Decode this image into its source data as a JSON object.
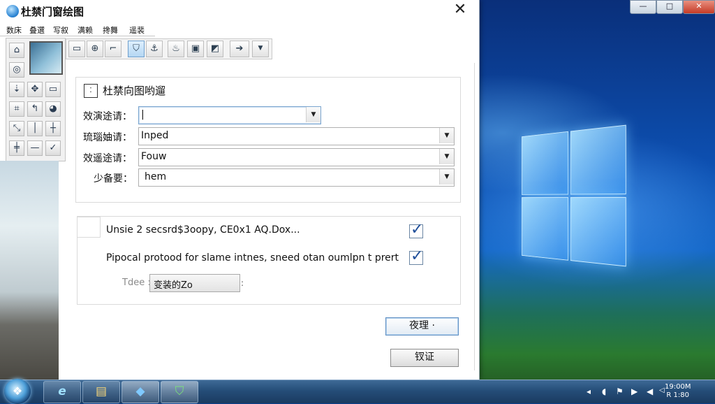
{
  "window": {
    "title": "杜禁门窗绘图",
    "close_glyph": "✕"
  },
  "menu": [
    "数床",
    "叠選",
    "写叙",
    "满赖",
    "搀舞",
    "遥裴"
  ],
  "left_tools": [
    {
      "icon": "home-icon",
      "glyph": "⌂"
    },
    {
      "icon": "circle-icon",
      "glyph": "◎"
    },
    {
      "icon": "arrow-down-icon",
      "glyph": "⇣"
    },
    {
      "icon": "move-icon",
      "glyph": "✥"
    },
    {
      "icon": "rectangle-icon",
      "glyph": "▭"
    },
    {
      "icon": "grid-icon",
      "glyph": "⌗"
    },
    {
      "icon": "arrow-curve-icon",
      "glyph": "↰"
    },
    {
      "icon": "globe-icon",
      "glyph": "◕"
    },
    {
      "icon": "diagonal-icon",
      "glyph": "⤡"
    },
    {
      "icon": "line-vertical-icon",
      "glyph": "│"
    },
    {
      "icon": "split-icon",
      "glyph": "┼"
    },
    {
      "icon": "join-icon",
      "glyph": "╪"
    },
    {
      "icon": "dash-icon",
      "glyph": "—"
    },
    {
      "icon": "check-curve-icon",
      "glyph": "✓"
    }
  ],
  "toolbar": [
    {
      "icon": "rectangle-icon",
      "glyph": "▭"
    },
    {
      "icon": "crosshair-icon",
      "glyph": "⊕"
    },
    {
      "icon": "line-icon",
      "glyph": "⌐"
    },
    {
      "icon": "shield-icon",
      "glyph": "⛉"
    },
    {
      "icon": "anchor-icon",
      "glyph": "⚓"
    },
    {
      "icon": "lamp-icon",
      "glyph": "♨"
    },
    {
      "icon": "panel-icon",
      "glyph": "▣"
    },
    {
      "icon": "color-icon",
      "glyph": "◩"
    },
    {
      "icon": "arrow-right-icon",
      "glyph": "➔"
    },
    {
      "icon": "dropdown-icon",
      "glyph": "▼"
    }
  ],
  "group1": {
    "title": "杜禁向图哟遛",
    "fields": [
      {
        "label": "效演途请：",
        "value": "|"
      },
      {
        "label": "琉瑙妯请：",
        "value": "Inped"
      },
      {
        "label": "效遥途请：",
        "value": "Fouw"
      },
      {
        "label": "少备要：",
        "value": "hem"
      }
    ]
  },
  "group2": {
    "options": [
      {
        "label": "Unsie 2 secsrd$3oopy, CE0x1 AQ.Dox...",
        "checked": true
      },
      {
        "label": "Pipocal protood for slame intnes, sneed otan oumlpn t prert",
        "checked": true
      }
    ],
    "small_label": "Tdee :",
    "small_input_value": "变装的Zo",
    "small_colon": ":"
  },
  "buttons": {
    "primary": "夜理 ·",
    "secondary": "钗证"
  },
  "desktop_window_buttons": {
    "minimize": "—",
    "maximize": "□",
    "close": "✕"
  },
  "taskbar": {
    "start_glyph": "❖",
    "apps": [
      {
        "icon": "internet-explorer-icon",
        "glyph": "e"
      },
      {
        "icon": "folder-icon",
        "glyph": "▤"
      },
      {
        "icon": "network-icon",
        "glyph": "◆"
      },
      {
        "icon": "shield-app-icon",
        "glyph": "⛉"
      }
    ],
    "tray_glyphs": [
      "◂",
      "◖",
      "⚑",
      "▶",
      "◀",
      "◁"
    ],
    "clock_time": "19:00M",
    "clock_date": "R 1:80"
  }
}
